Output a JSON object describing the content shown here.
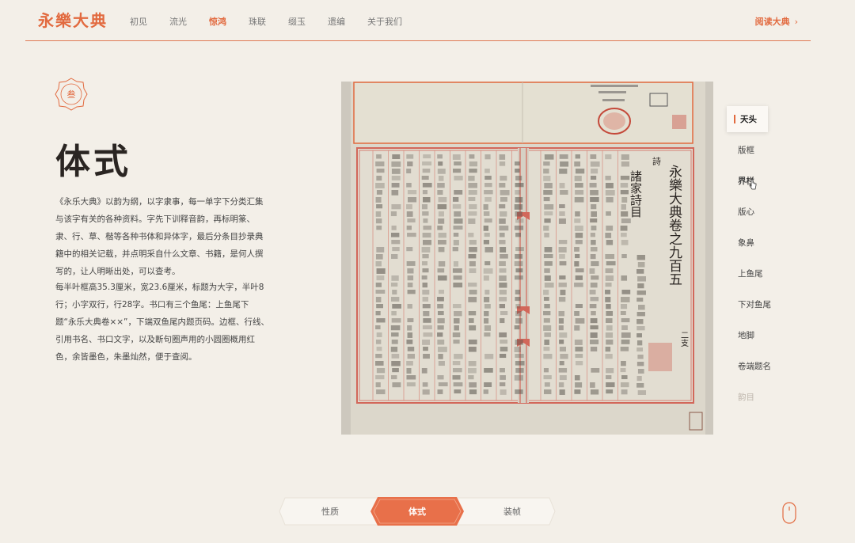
{
  "header": {
    "logo": "永樂大典",
    "nav": [
      "初见",
      "流光",
      "惊鸿",
      "珠联",
      "缀玉",
      "遗编",
      "关于我们"
    ],
    "active_nav": "惊鸿",
    "read_label": "阅读大典",
    "read_icon": "chevron-right-icon"
  },
  "section": {
    "badge": "叁",
    "title": "体式",
    "paragraph1": "《永乐大典》以韵为纲，以字隶事，每一单字下分类汇集与该字有关的各种资料。字先下训释音韵，再标明篆、隶、行、草、楷等各种书体和异体字，最后分条目抄录典籍中的相关记载，并点明采自什么文章、书籍，是何人撰写的，让人明晰出处，可以查考。",
    "paragraph2": "每半叶框高35.3厘米，宽23.6厘米，标题为大字，半叶8行；小字双行，行28字。书口有三个鱼尾：上鱼尾下题“永乐大典卷××”，下端双鱼尾内题页码。边框、行线、引用书名、书口文字，以及断句圈声用的小圆圈概用红色，余皆墨色，朱墨灿然，便于查阅。"
  },
  "book_image": {
    "title_text": "永樂大典卷之九百五",
    "subtitle_text": "諸家詩目",
    "page_number": "二支",
    "side_label": "詩"
  },
  "side_nav": {
    "items": [
      "天头",
      "版框",
      "界栏",
      "版心",
      "象鼻",
      "上鱼尾",
      "下对鱼尾",
      "地脚",
      "卷端题名",
      "韵目"
    ],
    "active": "天头",
    "hover": "界栏"
  },
  "bottom_tabs": {
    "items": [
      "性质",
      "体式",
      "装帧"
    ],
    "active": "体式"
  },
  "colors": {
    "accent": "#e26a3f",
    "background": "#f3efe8",
    "text": "#444444"
  }
}
